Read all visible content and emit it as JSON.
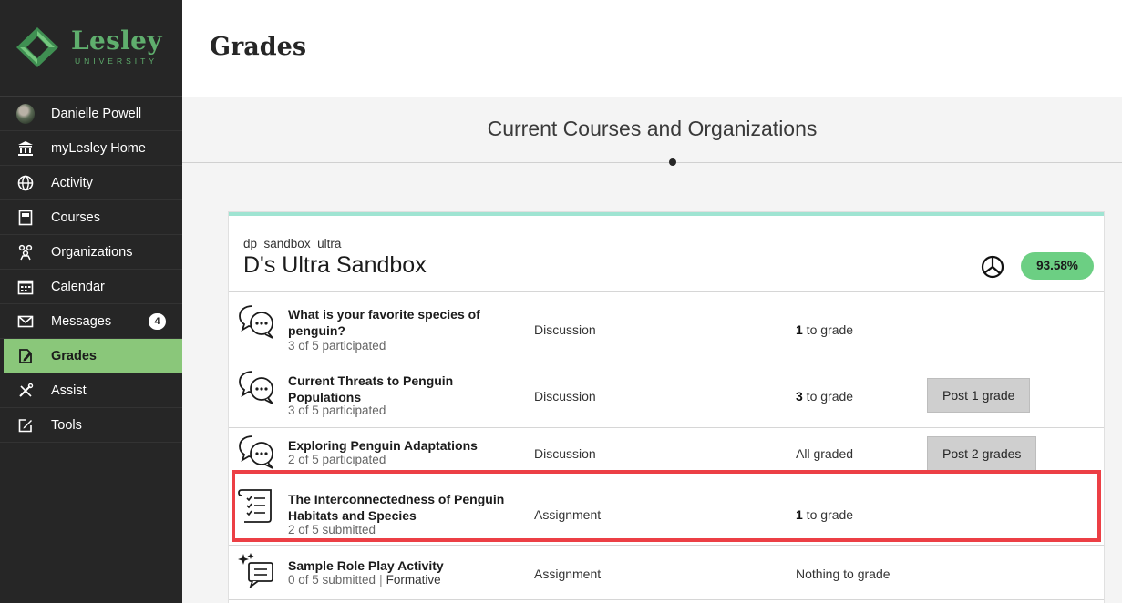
{
  "brand": {
    "name": "Lesley",
    "sub": "UNIVERSITY"
  },
  "sidebar": {
    "items": [
      {
        "label": "Danielle Powell",
        "icon": "avatar"
      },
      {
        "label": "myLesley Home",
        "icon": "institution-icon"
      },
      {
        "label": "Activity",
        "icon": "globe-icon"
      },
      {
        "label": "Courses",
        "icon": "book-icon"
      },
      {
        "label": "Organizations",
        "icon": "people-icon"
      },
      {
        "label": "Calendar",
        "icon": "calendar-icon"
      },
      {
        "label": "Messages",
        "icon": "envelope-icon",
        "badge": "4"
      },
      {
        "label": "Grades",
        "icon": "grades-icon",
        "active": true
      },
      {
        "label": "Assist",
        "icon": "tools-cross-icon"
      },
      {
        "label": "Tools",
        "icon": "edit-box-icon"
      }
    ]
  },
  "page": {
    "title": "Grades",
    "section_title": "Current Courses and Organizations"
  },
  "course": {
    "id": "dp_sandbox_ultra",
    "name": "D's Ultra Sandbox",
    "overall_grade": "93.58%"
  },
  "rows": [
    {
      "title": "What is your favorite species of penguin?",
      "sub": "3 of 5 participated",
      "type": "Discussion",
      "count": "1",
      "status": " to grade",
      "button": ""
    },
    {
      "title": "Current Threats to Penguin Populations",
      "sub": "3 of 5 participated",
      "type": "Discussion",
      "count": "3",
      "status": " to grade",
      "button": "Post 1 grade"
    },
    {
      "title": "Exploring Penguin Adaptations",
      "sub": "2 of 5 participated",
      "type": "Discussion",
      "count": "",
      "status": "All graded",
      "button": "Post 2 grades"
    },
    {
      "title": "The Interconnectedness of Penguin Habitats and Species",
      "sub": "2 of 5 submitted",
      "type": "Assignment",
      "count": "1",
      "status": " to grade",
      "button": ""
    },
    {
      "title": "Sample Role Play Activity",
      "sub": "0 of 5 submitted",
      "tag": "Formative",
      "type": "Assignment",
      "count": "",
      "status": "Nothing to grade",
      "button": ""
    }
  ],
  "colors": {
    "sidebar_bg": "#262626",
    "active_nav": "#8ac77a",
    "grade_pill": "#6ccf83",
    "card_accent": "#9fe4d2",
    "highlight": "#ec3f45"
  }
}
